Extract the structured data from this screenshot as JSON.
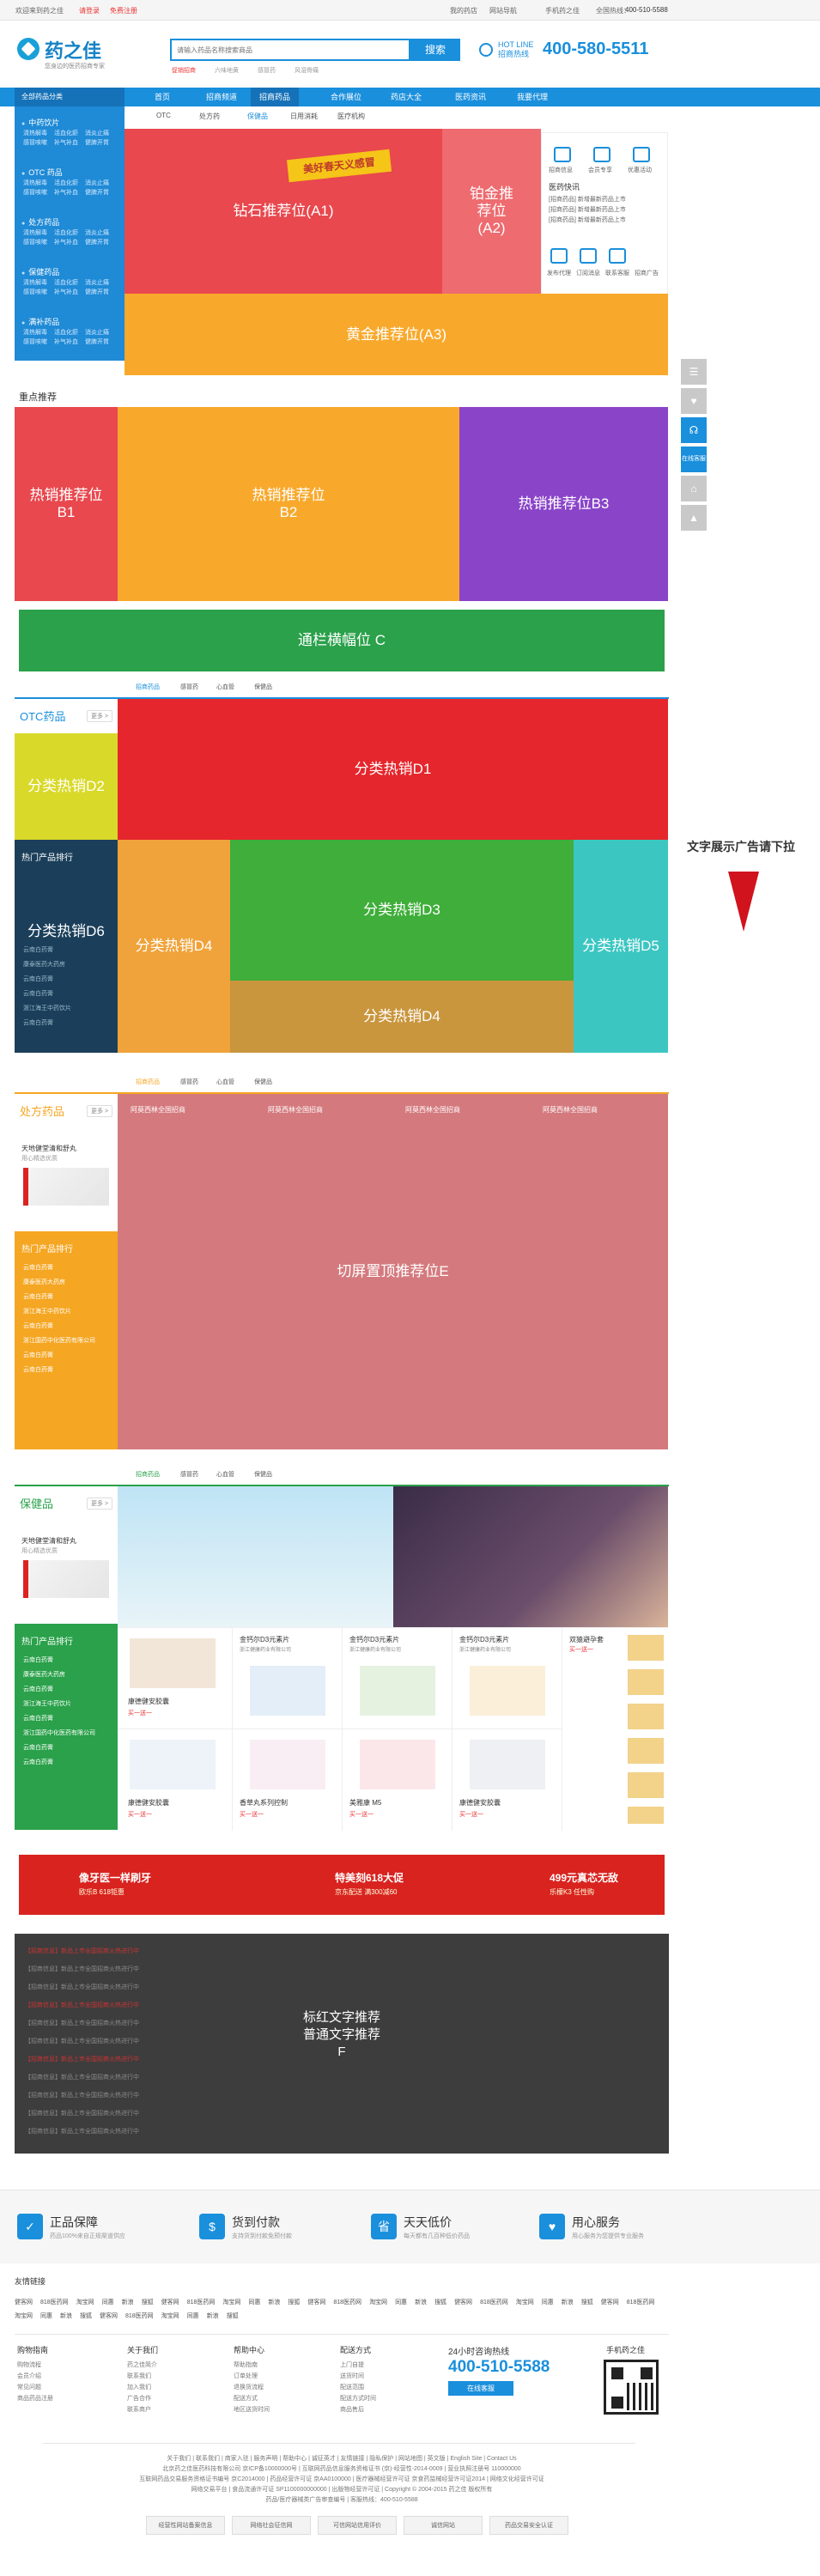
{
  "topbar": {
    "welcome": "欢迎来到药之佳",
    "login": "请登录",
    "register": "免费注册",
    "my_orders": "我的药店",
    "site_nav": "网站导航",
    "mobile": "手机药之佳",
    "hotline_label": "全国热线：",
    "hotline": "400-510-5588"
  },
  "header": {
    "logo_title": "药之佳",
    "logo_sub": "您身边的医药招商专家",
    "search_placeholder": "请输入药品名称搜索商品",
    "search_button": "搜索",
    "hot_words": [
      "促销招商",
      "六味地黄",
      "感冒药",
      "风湿骨痛"
    ],
    "hotline_label_1": "HOT LINE",
    "hotline_label_2": "招商热线",
    "hotline_number": "400-580-5511"
  },
  "nav": {
    "category_head": "全部药品分类",
    "items": [
      "首页",
      "招商频道",
      "招商药品",
      "合作展位",
      "药店大全",
      "医药资讯",
      "我要代理"
    ],
    "sub_items": [
      "OTC",
      "处方药",
      "保健品",
      "日用消耗",
      "医疗机构"
    ]
  },
  "side_menu": [
    {
      "title": "中药饮片",
      "links": [
        "清热解毒",
        "活血化瘀",
        "消炎止痛",
        "感冒咳嗽",
        "补气补血",
        "健脾开胃"
      ]
    },
    {
      "title": "OTC 药品",
      "links": [
        "清热解毒",
        "活血化瘀",
        "消炎止痛",
        "感冒咳嗽",
        "补气补血",
        "健脾开胃"
      ]
    },
    {
      "title": "处方药品",
      "links": [
        "清热解毒",
        "活血化瘀",
        "消炎止痛",
        "感冒咳嗽",
        "补气补血",
        "健脾开胃"
      ]
    },
    {
      "title": "保健药品",
      "links": [
        "清热解毒",
        "活血化瘀",
        "消炎止痛",
        "感冒咳嗽",
        "补气补血",
        "健脾开胃"
      ]
    },
    {
      "title": "满补药品",
      "links": [
        "清热解毒",
        "活血化瘀",
        "消炎止痛",
        "感冒咳嗽",
        "补气补血",
        "健脾开胃"
      ]
    }
  ],
  "hero": {
    "diamond": "钻石推荐位(A1)",
    "promo_banner": "美好春天义感冒",
    "platinum_1": "铂金推",
    "platinum_2": "荐位",
    "platinum_3": "(A2)",
    "gold": "黄金推荐位(A3)",
    "info_title": "医药快讯",
    "info_items": [
      "[招商药品] 新增最新药品上市",
      "[招商药品] 新增最新药品上市",
      "[招商药品] 新增最新药品上市"
    ],
    "services": [
      "发布代理",
      "订阅消息",
      "联系客服",
      "招商广告"
    ],
    "services_top": [
      "招商信息",
      "会员专享",
      "优惠活动"
    ]
  },
  "focus": {
    "title": "重点推荐",
    "b1_1": "热销推荐位",
    "b1_2": "B1",
    "b2_1": "热销推荐位",
    "b2_2": "B2",
    "b3": "热销推荐位B3"
  },
  "banner_c": "通栏横幅位 C",
  "otc": {
    "tabs": [
      "招商药品",
      "感冒药",
      "心血管",
      "保健品"
    ],
    "side_title": "OTC药品",
    "more": "更多 >",
    "d1": "分类热销D1",
    "d2": "分类热销D2",
    "d3": "分类热销D3",
    "d4a": "分类热销D4",
    "d4b": "分类热销D4",
    "d5": "分类热销D5",
    "d6": "分类热销D6",
    "rank_title": "热门产品排行",
    "rank": [
      "云南白药膏",
      "康泰医药大药房",
      "云南白药膏",
      "云南白药膏",
      "浙江海王中药饮片",
      "云南白药膏",
      "浙江国药中化医药有限公司",
      "云南白药膏",
      "云南白药膏"
    ]
  },
  "rx": {
    "tabs": [
      "招商药品",
      "感冒药",
      "心血管",
      "保健品"
    ],
    "side_title": "处方药品",
    "more": "更多 >",
    "feature": "切屏置顶推荐位E",
    "product_prefix": "阿莫西林全国招商",
    "rank_title": "热门产品排行",
    "rank": [
      "云南白药膏",
      "康泰医药大药房",
      "云南白药膏",
      "浙江海王中药饮片",
      "云南白药膏",
      "浙江国药中化医药有限公司",
      "云南白药膏",
      "云南白药膏"
    ],
    "tcm_title": "天地健堂清和舒丸",
    "tcm_sub": "用心精选优质"
  },
  "health": {
    "tabs": [
      "招商药品",
      "感冒药",
      "心血管",
      "保健品"
    ],
    "side_title": "保健品",
    "more": "更多 >",
    "tcm_title": "天地健堂清和舒丸",
    "tcm_sub": "用心精选优质",
    "rank_title": "热门产品排行",
    "rank": [
      "云南白药膏",
      "康泰医药大药房",
      "云南白药膏",
      "浙江海王中药饮片",
      "云南白药膏",
      "浙江国药中化医药有限公司",
      "云南白药膏",
      "云南白药膏"
    ],
    "products": [
      {
        "name": "康德健安胶囊",
        "sub": "买一送一"
      },
      {
        "name": "金钙尔D3元素片",
        "sub": "浙江健康药业有限公司"
      },
      {
        "name": "金钙尔D3元素片",
        "sub": "浙江健康药业有限公司"
      },
      {
        "name": "金钙尔D3元素片",
        "sub": "浙江健康药业有限公司"
      },
      {
        "name": "双猿避孕套",
        "sub": "买一送一"
      },
      {
        "name": "康德健安胶囊",
        "sub": "买一送一"
      },
      {
        "name": "香草丸系列控制",
        "sub": "买一送一"
      },
      {
        "name": "美雅康 M5",
        "sub": "买一送一"
      },
      {
        "name": "康德健安胶囊",
        "sub": "买一送一"
      },
      {
        "name": "双猿避孕套",
        "sub": "买一送一"
      }
    ]
  },
  "promo_strip": [
    {
      "title": "像牙医一样刷牙",
      "sub": "欧乐B 618钜惠"
    },
    {
      "title": "特美刻618大促",
      "sub": "京东配送 满300减60"
    },
    {
      "title": "499元真芯无敌",
      "sub": "乐檬K3 任性购"
    }
  ],
  "text_ads": {
    "center_1": "标红文字推荐",
    "center_2": "普通文字推荐",
    "center_3": "F",
    "line_text": "【招商信息】新品上市全国招商火热进行中"
  },
  "side_ad": {
    "text": "文字展示广告请下拉"
  },
  "side_tools": [
    "☰",
    "♥",
    "☊",
    "在线客服",
    "⌂",
    "▲"
  ],
  "features": [
    {
      "icon": "✓",
      "title": "正品保障",
      "sub": "药品100%来自正规渠道供应"
    },
    {
      "icon": "$",
      "title": "货到付款",
      "sub": "支持货到付款免预付款"
    },
    {
      "icon": "省",
      "title": "天天低价",
      "sub": "每天都有几百种低价药品"
    },
    {
      "icon": "♥",
      "title": "用心服务",
      "sub": "用心服务为您提供专业服务"
    }
  ],
  "links": {
    "head": "友情链接",
    "items": [
      "健客网",
      "818医药网",
      "淘宝网",
      "同惠",
      "新浪",
      "搜狐",
      "健客网",
      "818医药网",
      "淘宝网",
      "同惠",
      "新浪",
      "搜狐",
      "健客网",
      "818医药网",
      "淘宝网",
      "同惠",
      "新浪",
      "搜狐",
      "健客网",
      "818医药网",
      "淘宝网",
      "同惠",
      "新浪",
      "搜狐",
      "健客网",
      "818医药网",
      "淘宝网",
      "同惠",
      "新浪",
      "搜狐",
      "健客网",
      "818医药网",
      "淘宝网",
      "同惠",
      "新浪",
      "搜狐"
    ]
  },
  "footer": {
    "cols": [
      {
        "title": "购物指南",
        "items": [
          "购物流程",
          "会员介绍",
          "常见问题",
          "商品药品注册"
        ]
      },
      {
        "title": "关于我们",
        "items": [
          "药之佳简介",
          "联系我们",
          "加入我们",
          "广告合作",
          "联系商户"
        ]
      },
      {
        "title": "帮助中心",
        "items": [
          "帮助指南",
          "订单处理",
          "退换货流程",
          "配送方式",
          "地区送货时间"
        ]
      },
      {
        "title": "配送方式",
        "items": [
          "上门自提",
          "送货时间",
          "配送范围",
          "配送方式时间",
          "商品售后"
        ]
      }
    ],
    "hotline_label": "24小时咨询热线",
    "hotline": "400-510-5588",
    "online": "在线客服",
    "qr_label": "手机药之佳",
    "bottom_links": "关于我们 | 联系我们 | 商家入驻 | 服务声明 | 帮助中心 | 诚征英才 | 友情链接 | 隐私保护 | 网站地图 | 英文版 | English Site | Contact Us",
    "bottom_lines": [
      "北京药之佳医药科技有限公司 京ICP备10000000号 | 互联网药品信息服务资格证书 (京)-经营性-2014-0009 | 营业执照注册号 110000000",
      "互联网药品交易服务资格证书编号 京C2014000 | 药品经营许可证 京AA0100000 | 医疗器械经营许可证 京食药监械经营许可证2014 | 网络文化经营许可证",
      "网络交易平台 | 食品流通许可证 SP1100000000000 | 出版物经营许可证 | Copyright © 2004-2015 药之佳 版权所有",
      "药品/医疗器械类广告审查编号 | 客服热线：400-510-5588"
    ],
    "badges": [
      "经营性网站备案信息",
      "网络社会征信网",
      "可信网站信用评价",
      "诚信网站",
      "药品交易安全认证",
      "网络110报警服务"
    ]
  }
}
